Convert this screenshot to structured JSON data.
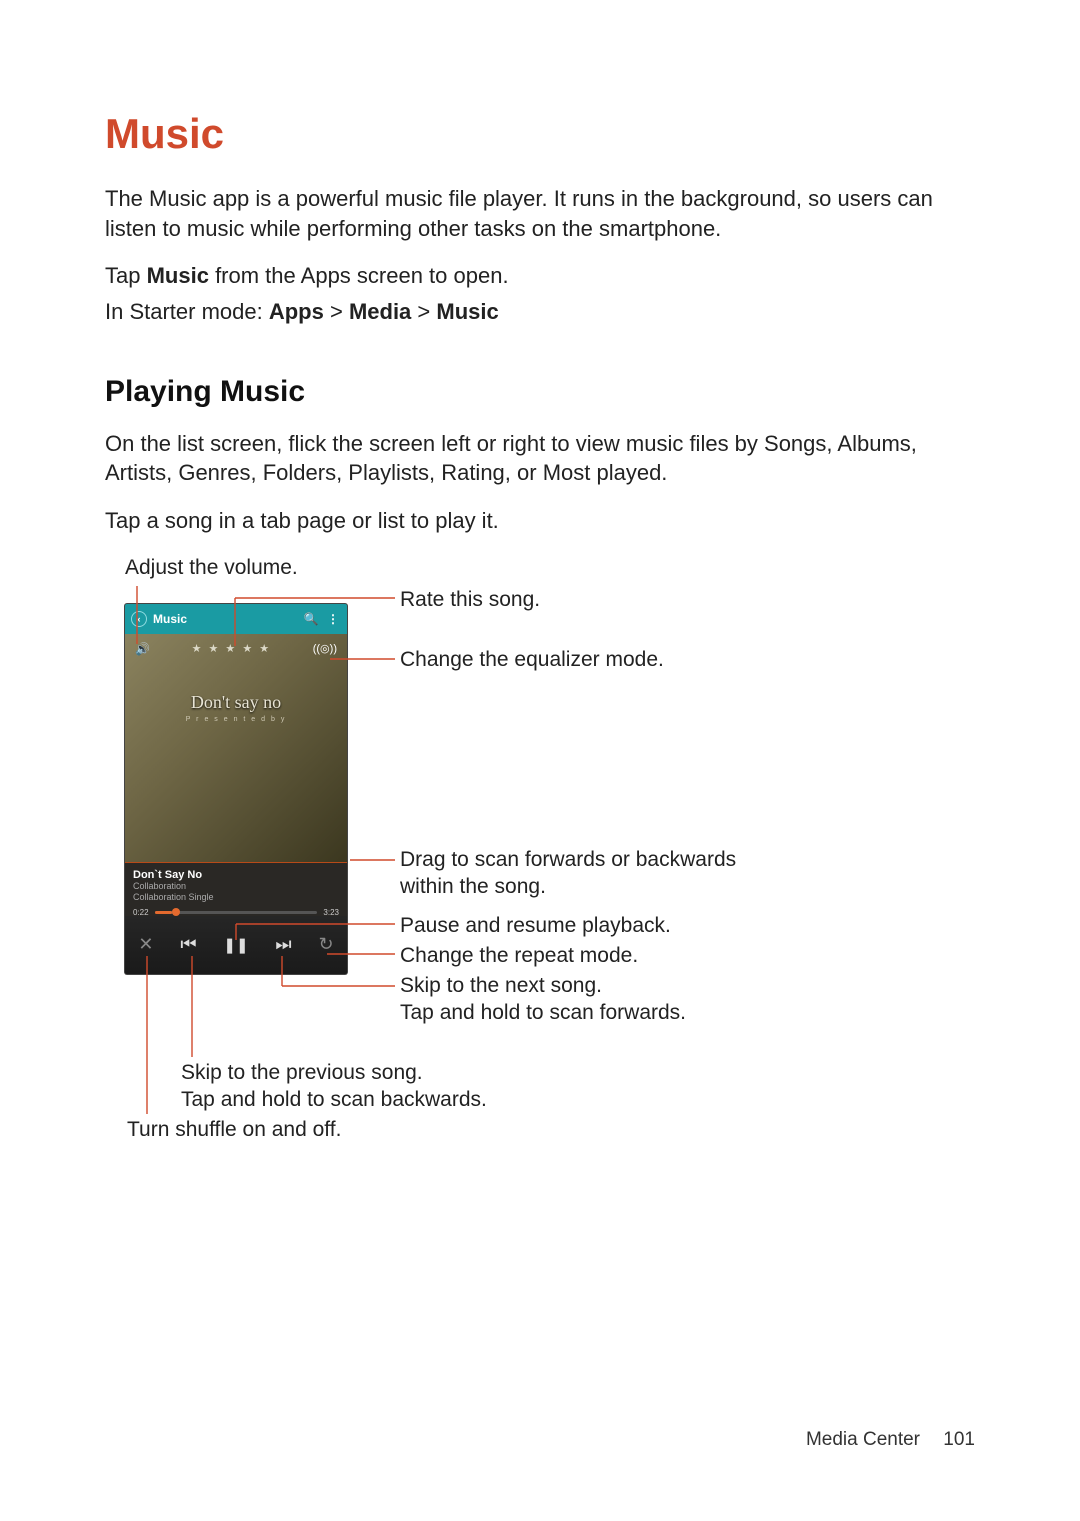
{
  "heading": "Music",
  "intro": "The Music app is a powerful music file player. It runs in the background, so users can listen to music while performing other tasks on the smartphone.",
  "open_line": {
    "pre": "Tap ",
    "bold": "Music",
    "post": " from the Apps screen to open."
  },
  "starter_line": {
    "pre": "In Starter mode: ",
    "path1": "Apps",
    "sep": " > ",
    "path2": "Media",
    "path3": "Music"
  },
  "subheading": "Playing Music",
  "play_desc": "On the list screen, flick the screen left or right to view music files by Songs, Albums, Artists, Genres, Folders, Playlists, Rating, or Most played.",
  "play_desc2": "Tap a song in a tab page or list to play it.",
  "phone": {
    "header_title": "Music",
    "back_glyph": "‹",
    "search_glyph": "🔍",
    "more_glyph": "⋮",
    "vol_glyph": "🔊",
    "stars": "★ ★ ★ ★ ★",
    "eq_glyph": "((◎))",
    "album_art_title": "Don't say no",
    "album_art_sub": "P r e s e n t e d   b y",
    "song_title": "Don`t Say No",
    "song_artist": "Collaboration",
    "song_album": "Collaboration Single",
    "elapsed": "0:22",
    "total": "3:23",
    "ctrl_shuffle": "✕",
    "ctrl_prev": "⏮",
    "ctrl_pause": "❚❚",
    "ctrl_next": "⏭",
    "ctrl_repeat": "↻"
  },
  "callouts": {
    "volume": "Adjust the volume.",
    "rate": "Rate this song.",
    "eq": "Change the equalizer mode.",
    "seek_l1": "Drag to scan forwards or backwards",
    "seek_l2": "within the song.",
    "pause": "Pause and resume playback.",
    "repeat": "Change the repeat mode.",
    "next_l1": "Skip to the next song.",
    "next_l2": "Tap and hold to scan forwards.",
    "prev_l1": "Skip to the previous song.",
    "prev_l2": "Tap and hold to scan backwards.",
    "shuffle": "Turn shuffle on and off."
  },
  "footer": {
    "section": "Media Center",
    "page": "101"
  }
}
